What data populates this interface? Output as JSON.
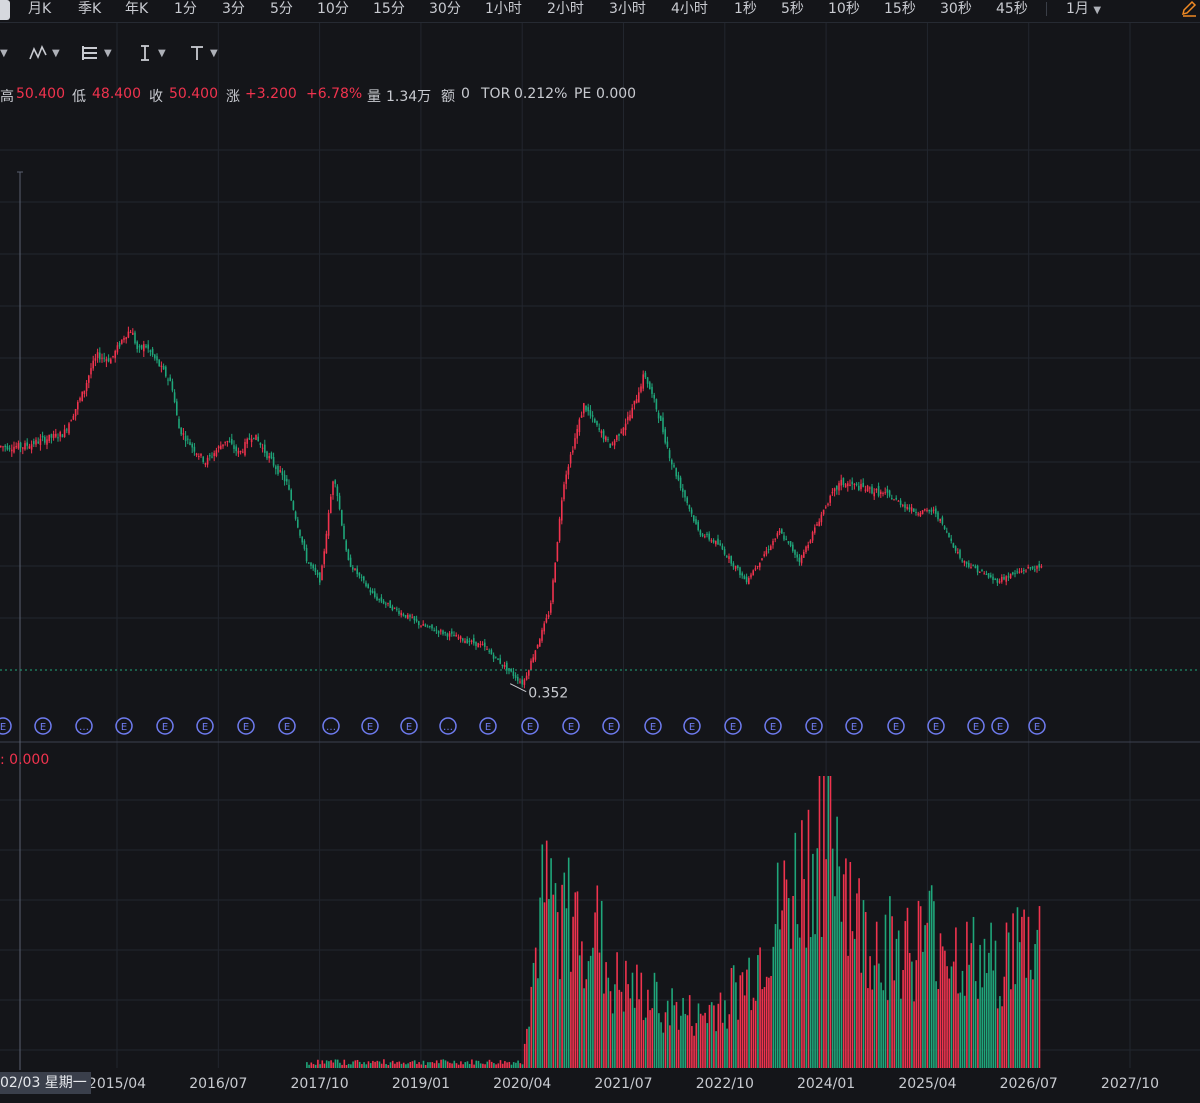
{
  "toolbar": {
    "periods": [
      "月K",
      "季K",
      "年K",
      "1分",
      "3分",
      "5分",
      "10分",
      "15分",
      "30分",
      "1小时",
      "2小时",
      "3小时",
      "4小时",
      "1秒",
      "5秒",
      "10秒",
      "15秒",
      "30秒",
      "45秒"
    ],
    "dropdown": "1月"
  },
  "info": {
    "high_label": "高",
    "high": "50.400",
    "low_label": "低",
    "low": "48.400",
    "close_label": "收",
    "close": "50.400",
    "change_label": "涨",
    "change": "+3.200",
    "change_pct": "+6.78%",
    "volume_label": "量",
    "volume": "1.34万",
    "amount_label": "额",
    "amount": "0",
    "tor_label": "TOR",
    "tor": "0.212%",
    "pe_label": "PE",
    "pe": "0.000"
  },
  "volume_panel": {
    "label": ": 0.000"
  },
  "crosshair": {
    "date": "02/03 星期一"
  },
  "colors": {
    "up": "#f0334e",
    "down": "#1fa67a",
    "bg": "#141519",
    "grid": "#22262e",
    "marker": "#6f7cf0"
  },
  "markers": [
    "E",
    "E",
    "…",
    "E",
    "E",
    "E",
    "E",
    "E",
    "…",
    "E",
    "E",
    "…",
    "E",
    "E",
    "E",
    "E",
    "E",
    "E",
    "E",
    "E",
    "E",
    "E",
    "E",
    "E",
    "E",
    "E",
    "E",
    "E"
  ],
  "chart_data": {
    "type": "candlestick",
    "x_ticks": [
      "2015/04",
      "2016/07",
      "2017/10",
      "2019/01",
      "2020/04",
      "2021/07",
      "2022/10",
      "2024/01",
      "2025/04",
      "2026/07",
      "2027/10"
    ],
    "min_label": "0.352",
    "price_series": [
      {
        "date": "2014/02",
        "close": 10
      },
      {
        "date": "2014/05",
        "close": 11
      },
      {
        "date": "2014/08",
        "close": 12
      },
      {
        "date": "2014/11",
        "close": 22
      },
      {
        "date": "2014/12",
        "close": 30
      },
      {
        "date": "2015/01",
        "close": 36
      },
      {
        "date": "2015/03",
        "close": 34
      },
      {
        "date": "2015/05",
        "close": 48
      },
      {
        "date": "2015/06",
        "close": 52
      },
      {
        "date": "2015/07",
        "close": 38
      },
      {
        "date": "2015/08",
        "close": 42
      },
      {
        "date": "2015/10",
        "close": 32
      },
      {
        "date": "2015/12",
        "close": 24
      },
      {
        "date": "2016/01",
        "close": 13
      },
      {
        "date": "2016/03",
        "close": 10
      },
      {
        "date": "2016/05",
        "close": 8
      },
      {
        "date": "2016/08",
        "close": 11
      },
      {
        "date": "2016/10",
        "close": 9
      },
      {
        "date": "2016/12",
        "close": 12
      },
      {
        "date": "2017/02",
        "close": 9
      },
      {
        "date": "2017/05",
        "close": 6
      },
      {
        "date": "2017/08",
        "close": 2
      },
      {
        "date": "2017/10",
        "close": 1.5
      },
      {
        "date": "2017/12",
        "close": 7
      },
      {
        "date": "2018/02",
        "close": 2
      },
      {
        "date": "2018/06",
        "close": 1.2
      },
      {
        "date": "2019/01",
        "close": 0.8
      },
      {
        "date": "2019/10",
        "close": 0.6
      },
      {
        "date": "2020/04",
        "close": 0.352
      },
      {
        "date": "2020/08",
        "close": 1
      },
      {
        "date": "2020/10",
        "close": 6
      },
      {
        "date": "2021/01",
        "close": 18
      },
      {
        "date": "2021/03",
        "close": 13
      },
      {
        "date": "2021/05",
        "close": 10
      },
      {
        "date": "2021/08",
        "close": 16
      },
      {
        "date": "2021/10",
        "close": 28
      },
      {
        "date": "2021/12",
        "close": 16
      },
      {
        "date": "2022/02",
        "close": 8
      },
      {
        "date": "2022/06",
        "close": 3
      },
      {
        "date": "2022/09",
        "close": 2.5
      },
      {
        "date": "2023/01",
        "close": 1.5
      },
      {
        "date": "2023/06",
        "close": 3
      },
      {
        "date": "2023/09",
        "close": 2
      },
      {
        "date": "2024/01",
        "close": 4.5
      },
      {
        "date": "2024/03",
        "close": 6
      },
      {
        "date": "2024/07",
        "close": 5.5
      },
      {
        "date": "2024/10",
        "close": 5
      },
      {
        "date": "2025/02",
        "close": 4
      },
      {
        "date": "2025/05",
        "close": 4
      },
      {
        "date": "2025/09",
        "close": 2
      },
      {
        "date": "2026/02",
        "close": 1.5
      },
      {
        "date": "2026/07",
        "close": 1.8
      }
    ],
    "volume_series": [
      {
        "date": "2017/10",
        "value": 0.05
      },
      {
        "date": "2020/04",
        "value": 0.1
      },
      {
        "date": "2020/07",
        "value": 0.68
      },
      {
        "date": "2021/03",
        "value": 0.56
      },
      {
        "date": "2021/05",
        "value": 0.35
      },
      {
        "date": "2022/06",
        "value": 0.2
      },
      {
        "date": "2023/01",
        "value": 0.35
      },
      {
        "date": "2024/01",
        "value": 1.0
      },
      {
        "date": "2024/03",
        "value": 0.91
      },
      {
        "date": "2024/06",
        "value": 0.55
      },
      {
        "date": "2024/10",
        "value": 0.51
      },
      {
        "date": "2025/02",
        "value": 0.5
      },
      {
        "date": "2025/05",
        "value": 0.57
      },
      {
        "date": "2025/09",
        "value": 0.45
      },
      {
        "date": "2026/02",
        "value": 0.42
      },
      {
        "date": "2026/06",
        "value": 0.52
      }
    ]
  }
}
